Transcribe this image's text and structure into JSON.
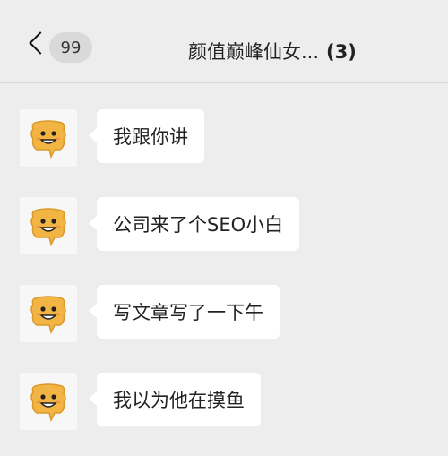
{
  "header": {
    "unread_count": "99",
    "title": "颜值巅峰仙女...",
    "member_count": "(3)"
  },
  "messages": [
    {
      "text": "我跟你讲"
    },
    {
      "text": "公司来了个SEO小白"
    },
    {
      "text": "写文章写了一下午"
    },
    {
      "text": "我以为他在摸鱼"
    }
  ],
  "icons": {
    "back": "chevron-left-icon",
    "avatar": "smiling-block-avatar-icon"
  },
  "colors": {
    "background": "#ededed",
    "bubble": "#ffffff",
    "avatar_face": "#f2b544"
  }
}
